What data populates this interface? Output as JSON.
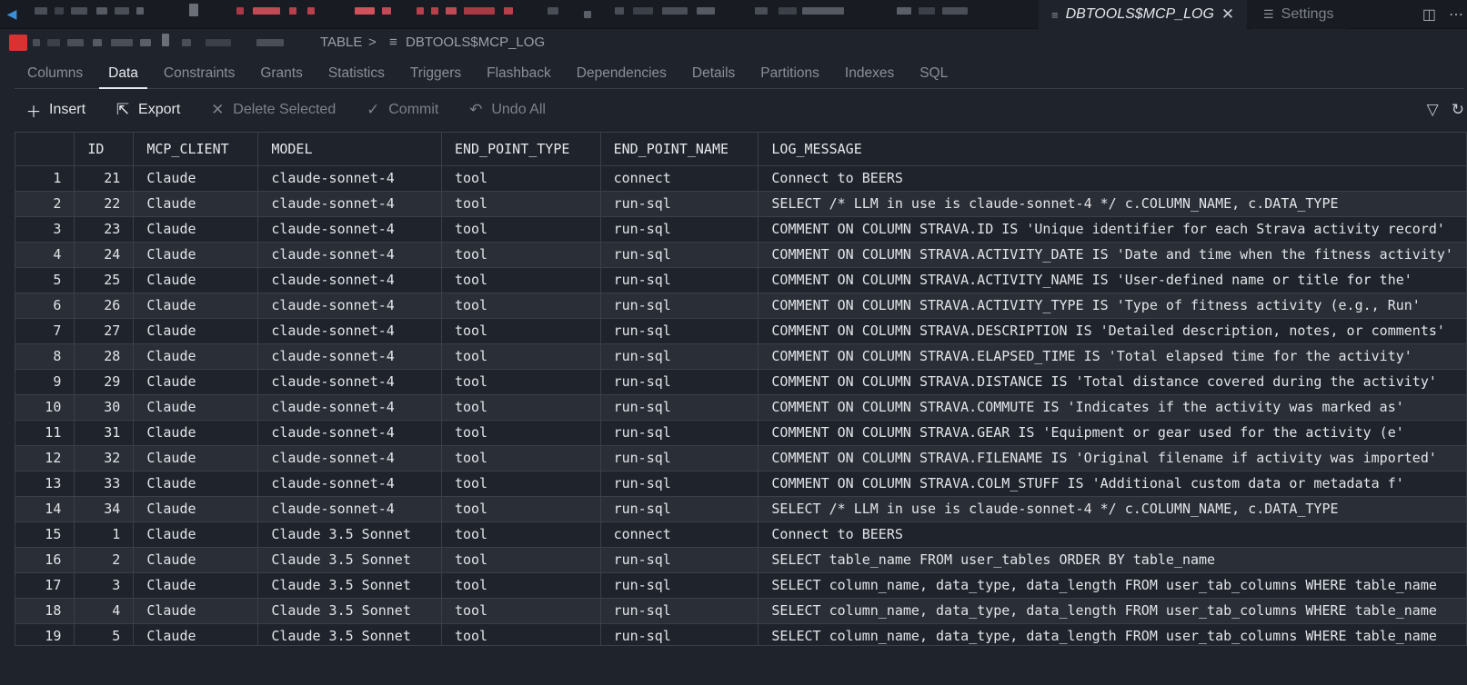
{
  "editor_tabs": {
    "active": {
      "label": "DBTOOLS$MCP_LOG"
    },
    "settings": {
      "label": "Settings"
    }
  },
  "breadcrumb": {
    "object_type": "TABLE",
    "separator": ">",
    "object_name": "DBTOOLS$MCP_LOG"
  },
  "object_tabs": [
    "Columns",
    "Data",
    "Constraints",
    "Grants",
    "Statistics",
    "Triggers",
    "Flashback",
    "Dependencies",
    "Details",
    "Partitions",
    "Indexes",
    "SQL"
  ],
  "toolbar": {
    "insert": "Insert",
    "export": "Export",
    "delete_selected": "Delete Selected",
    "commit": "Commit",
    "undo_all": "Undo All"
  },
  "grid": {
    "columns": [
      "",
      "ID",
      "MCP_CLIENT",
      "MODEL",
      "END_POINT_TYPE",
      "END_POINT_NAME",
      "LOG_MESSAGE"
    ],
    "rows": [
      [
        "1",
        "21",
        "Claude",
        "claude-sonnet-4",
        "tool",
        "connect",
        "Connect to BEERS"
      ],
      [
        "2",
        "22",
        "Claude",
        "claude-sonnet-4",
        "tool",
        "run-sql",
        "SELECT /* LLM in use is claude-sonnet-4 */      c.COLUMN_NAME,     c.DATA_TYPE"
      ],
      [
        "3",
        "23",
        "Claude",
        "claude-sonnet-4",
        "tool",
        "run-sql",
        "COMMENT ON COLUMN STRAVA.ID IS 'Unique identifier for each Strava activity record'"
      ],
      [
        "4",
        "24",
        "Claude",
        "claude-sonnet-4",
        "tool",
        "run-sql",
        "COMMENT ON COLUMN STRAVA.ACTIVITY_DATE IS 'Date and time when the fitness activity'"
      ],
      [
        "5",
        "25",
        "Claude",
        "claude-sonnet-4",
        "tool",
        "run-sql",
        "COMMENT ON COLUMN STRAVA.ACTIVITY_NAME IS 'User-defined name or title for the'"
      ],
      [
        "6",
        "26",
        "Claude",
        "claude-sonnet-4",
        "tool",
        "run-sql",
        "COMMENT ON COLUMN STRAVA.ACTIVITY_TYPE IS 'Type of fitness activity (e.g., Run'"
      ],
      [
        "7",
        "27",
        "Claude",
        "claude-sonnet-4",
        "tool",
        "run-sql",
        "COMMENT ON COLUMN STRAVA.DESCRIPTION IS 'Detailed description, notes, or comments'"
      ],
      [
        "8",
        "28",
        "Claude",
        "claude-sonnet-4",
        "tool",
        "run-sql",
        "COMMENT ON COLUMN STRAVA.ELAPSED_TIME IS 'Total elapsed time for the activity'"
      ],
      [
        "9",
        "29",
        "Claude",
        "claude-sonnet-4",
        "tool",
        "run-sql",
        "COMMENT ON COLUMN STRAVA.DISTANCE IS 'Total distance covered during the activity'"
      ],
      [
        "10",
        "30",
        "Claude",
        "claude-sonnet-4",
        "tool",
        "run-sql",
        "COMMENT ON COLUMN STRAVA.COMMUTE IS 'Indicates if the activity was marked as'"
      ],
      [
        "11",
        "31",
        "Claude",
        "claude-sonnet-4",
        "tool",
        "run-sql",
        "COMMENT ON COLUMN STRAVA.GEAR IS 'Equipment or gear used for the activity (e'"
      ],
      [
        "12",
        "32",
        "Claude",
        "claude-sonnet-4",
        "tool",
        "run-sql",
        "COMMENT ON COLUMN STRAVA.FILENAME IS 'Original filename if activity was imported'"
      ],
      [
        "13",
        "33",
        "Claude",
        "claude-sonnet-4",
        "tool",
        "run-sql",
        "COMMENT ON COLUMN STRAVA.COLM_STUFF IS 'Additional custom data or metadata f'"
      ],
      [
        "14",
        "34",
        "Claude",
        "claude-sonnet-4",
        "tool",
        "run-sql",
        "SELECT /* LLM in use is claude-sonnet-4 */      c.COLUMN_NAME,     c.DATA_TYPE"
      ],
      [
        "15",
        "1",
        "Claude",
        "Claude 3.5 Sonnet",
        "tool",
        "connect",
        "Connect to BEERS"
      ],
      [
        "16",
        "2",
        "Claude",
        "Claude 3.5 Sonnet",
        "tool",
        "run-sql",
        "SELECT table_name FROM user_tables ORDER BY table_name"
      ],
      [
        "17",
        "3",
        "Claude",
        "Claude 3.5 Sonnet",
        "tool",
        "run-sql",
        "SELECT column_name, data_type, data_length FROM user_tab_columns WHERE table_name"
      ],
      [
        "18",
        "4",
        "Claude",
        "Claude 3.5 Sonnet",
        "tool",
        "run-sql",
        "SELECT column_name, data_type, data_length FROM user_tab_columns WHERE table_name"
      ],
      [
        "19",
        "5",
        "Claude",
        "Claude 3.5 Sonnet",
        "tool",
        "run-sql",
        "SELECT column_name, data_type, data_length FROM user_tab_columns WHERE table_name"
      ]
    ]
  },
  "colors": {
    "background": "#1f232b",
    "row_alt": "#2a2e36",
    "tabstrip": "#181b21",
    "border": "#3a3f48",
    "accent_red": "#d93232",
    "back_arrow": "#3b8fd9"
  },
  "icons": {
    "back": "arrow-left-icon",
    "close_tab": "close-icon",
    "settings": "sliders-icon",
    "split": "split-editor-icon",
    "more": "ellipsis-icon",
    "table": "table-icon",
    "insert": "plus-icon",
    "export": "export-icon",
    "delete": "x-icon",
    "commit": "check-icon",
    "undo": "undo-icon",
    "filter": "filter-icon",
    "refresh": "refresh-icon"
  }
}
